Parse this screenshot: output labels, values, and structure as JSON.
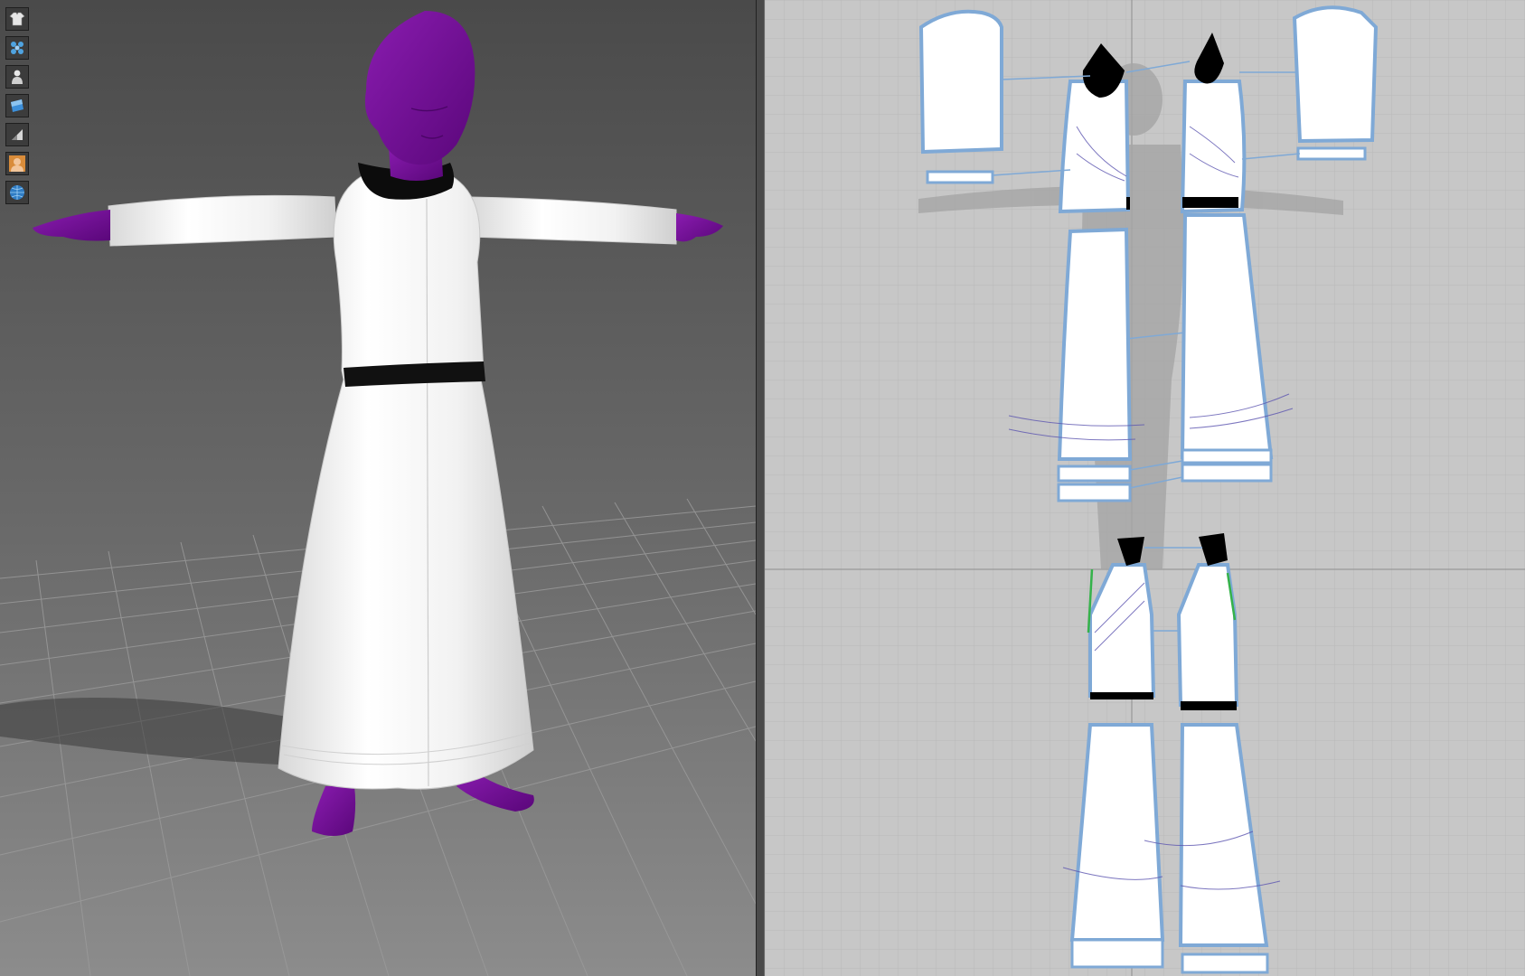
{
  "toolbar": {
    "tools": [
      {
        "icon": "garment-icon"
      },
      {
        "icon": "particle-icon"
      },
      {
        "icon": "avatar-icon"
      },
      {
        "icon": "fabric-icon"
      },
      {
        "icon": "pin-icon"
      },
      {
        "icon": "avatar-face-icon"
      },
      {
        "icon": "globe-icon"
      }
    ]
  },
  "colors": {
    "avatar": "#6a0a8c",
    "garment": "#f4f4f4",
    "trim": "#111111",
    "pattern_outline": "#7fa9d6",
    "viewport2d_bg": "#c7c7c7",
    "viewport3d_bg_top": "#4d4d4d",
    "viewport3d_bg_bottom": "#8a8a8a"
  }
}
